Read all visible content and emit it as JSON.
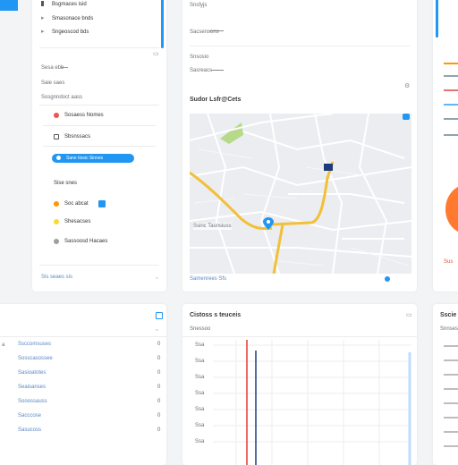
{
  "colors": {
    "accent": "#2196f3",
    "danger": "#e53935",
    "navy": "#1f3a7a",
    "orange": "#ff7a2e",
    "green": "#9ccc65",
    "road": "#f2c037"
  },
  "left": {
    "header_items": [
      {
        "label": "Bsgmaces isid"
      },
      {
        "label": "Smasonace bnds"
      },
      {
        "label": "Sngeoscod bds"
      }
    ],
    "row1_label": "Sesa ebb",
    "row2_label": "Saie saes",
    "row3_label": "Sosgnndoct aass",
    "menu": [
      {
        "label": "Sosaess Nomes"
      },
      {
        "label": "Sbsnssacs"
      },
      {
        "label": "Sane tiosic Sinnes"
      }
    ],
    "subhead": "Sise snes",
    "menu2": [
      {
        "label": "Soc abcat"
      },
      {
        "label": "Shesacses"
      },
      {
        "label": "Sassoosd Hacaes"
      }
    ],
    "footer": "Sis seaes sis"
  },
  "center": {
    "lines": [
      "Snsfyjs",
      "Sacsensons",
      "Snsosio",
      "Sasreacs"
    ],
    "map_title": "Sudor Lsfr@Cets",
    "map_label": "Ssinc Tasnsiuss",
    "footer": "Samenrees Sfs"
  },
  "right": {
    "labels": [
      "Sus"
    ]
  },
  "bottom_left": {
    "rows": [
      {
        "label": "Ssccomsuses",
        "value": "0"
      },
      {
        "label": "Sosscasossee",
        "value": "0"
      },
      {
        "label": "Sasioatotes",
        "value": "0"
      },
      {
        "label": "Seaisanses",
        "value": "0"
      },
      {
        "label": "Sooossauss",
        "value": "0"
      },
      {
        "label": "Sacccose",
        "value": "0"
      },
      {
        "label": "Sasucoss",
        "value": "0"
      }
    ]
  },
  "bottom_center": {
    "title": "Cistoss s teuceis",
    "sub": "Snessoo",
    "y_labels": [
      "Ssa",
      "Ssa",
      "Ssa",
      "Ssa",
      "Ssa",
      "Ssa",
      "Ssa"
    ]
  },
  "bottom_right": {
    "title": "Sscie",
    "sub": "Snnsess"
  }
}
